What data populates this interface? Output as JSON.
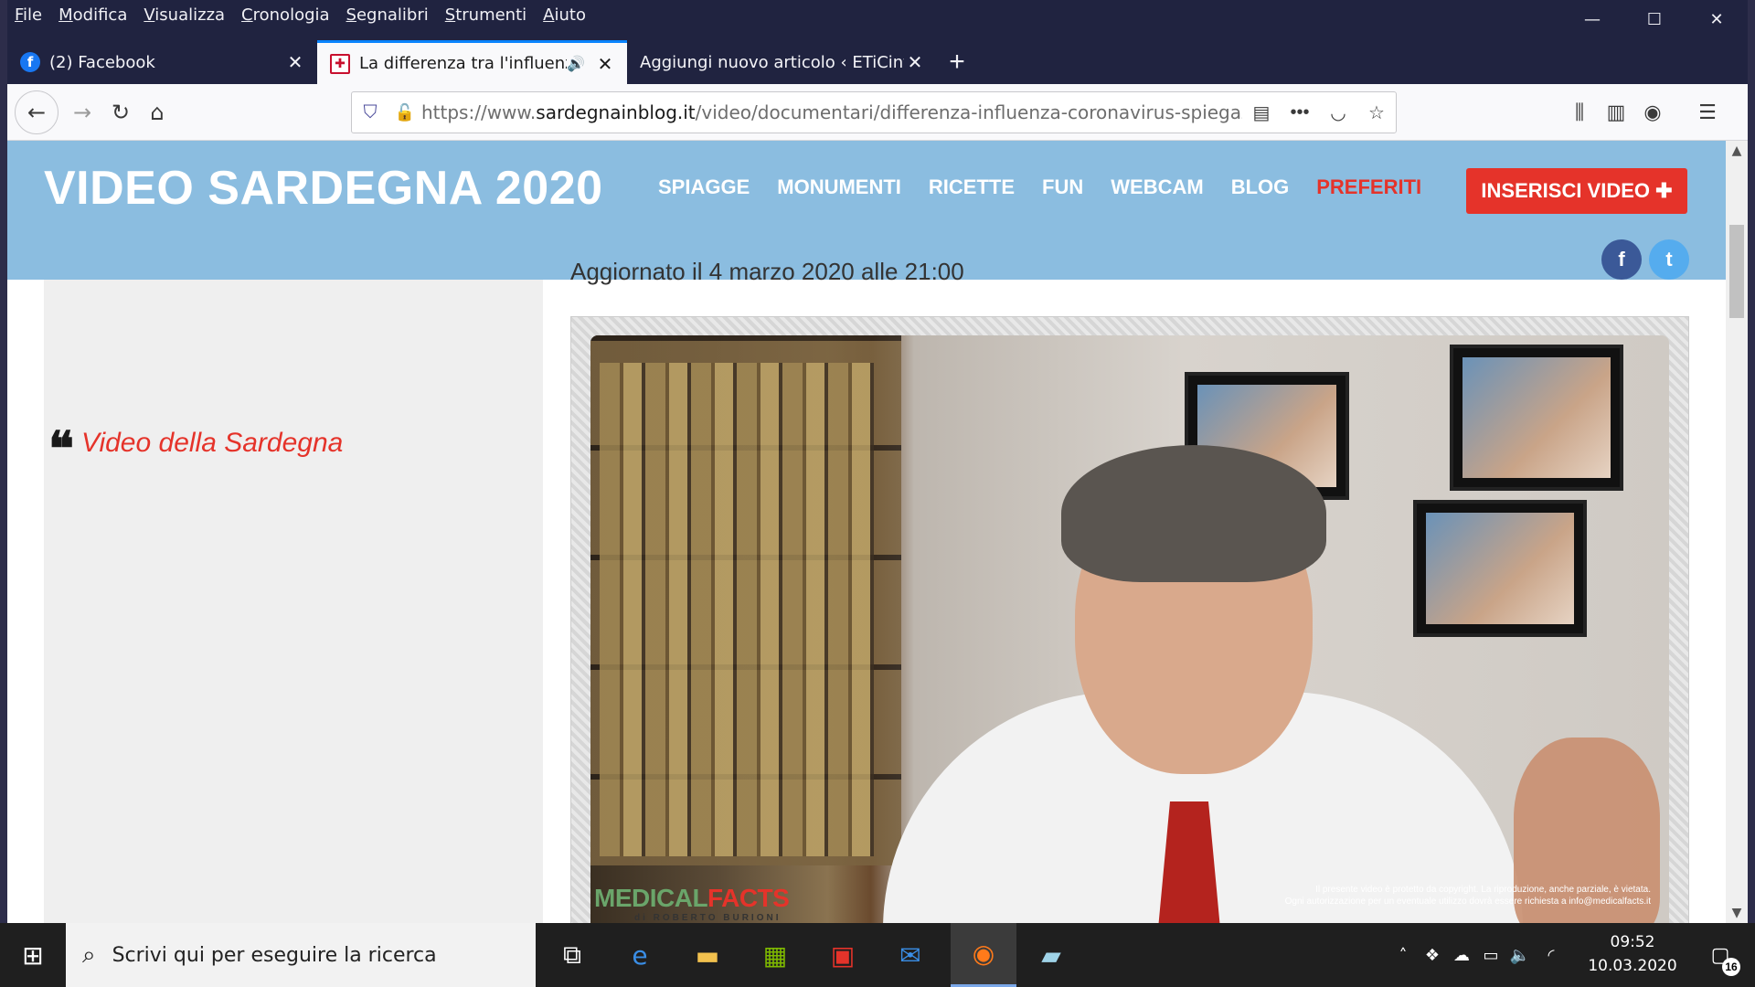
{
  "menubar": [
    "File",
    "Modifica",
    "Visualizza",
    "Cronologia",
    "Segnalibri",
    "Strumenti",
    "Aiuto"
  ],
  "window_controls": {
    "minimize": "—",
    "maximize": "☐",
    "close": "✕"
  },
  "tabs": [
    {
      "title": "(2) Facebook",
      "favicon": "facebook-icon",
      "active": false
    },
    {
      "title": "La differenza tra l'influenza e",
      "favicon": "sardegna-flag-icon",
      "active": true,
      "sound": true
    },
    {
      "title": "Aggiungi nuovo articolo ‹ ETiCinformazione",
      "favicon": "none",
      "active": false
    }
  ],
  "toolbar": {
    "url_scheme": "https://www.",
    "url_host": "sardegnainblog.it",
    "url_path": "/video/documentari/differenza-influenza-coronavirus-spiegazione"
  },
  "site": {
    "logo": "VIDEO SARDEGNA 2020",
    "nav": [
      "SPIAGGE",
      "MONUMENTI",
      "RICETTE",
      "FUN",
      "WEBCAM",
      "BLOG",
      "PREFERITI"
    ],
    "cta": "INSERISCI VIDEO ✚",
    "social": {
      "facebook": "f",
      "twitter": "t"
    },
    "sidebar_quote": "Video della Sardegna",
    "updated": "Aggiornato il 4 marzo 2020 alle 21:00",
    "video": {
      "brand_medical": "MEDICAL",
      "brand_facts": "FACTS",
      "brand_sub": "di ROBERTO BURIONI",
      "copyright_line1": "Il presente video è protetto da copyright. La riproduzione, anche parziale, è vietata.",
      "copyright_line2": "Ogni autorizzazione per un eventuale utilizzo dovrà essere richiesta a info@medicalfacts.it"
    }
  },
  "taskbar": {
    "search_placeholder": "Scrivi qui per eseguire la ricerca",
    "time": "09:52",
    "date": "10.03.2020",
    "notifications": "16"
  },
  "colors": {
    "header_bg": "#8bbde0",
    "accent_red": "#e5332a",
    "titlebar": "#202340"
  }
}
